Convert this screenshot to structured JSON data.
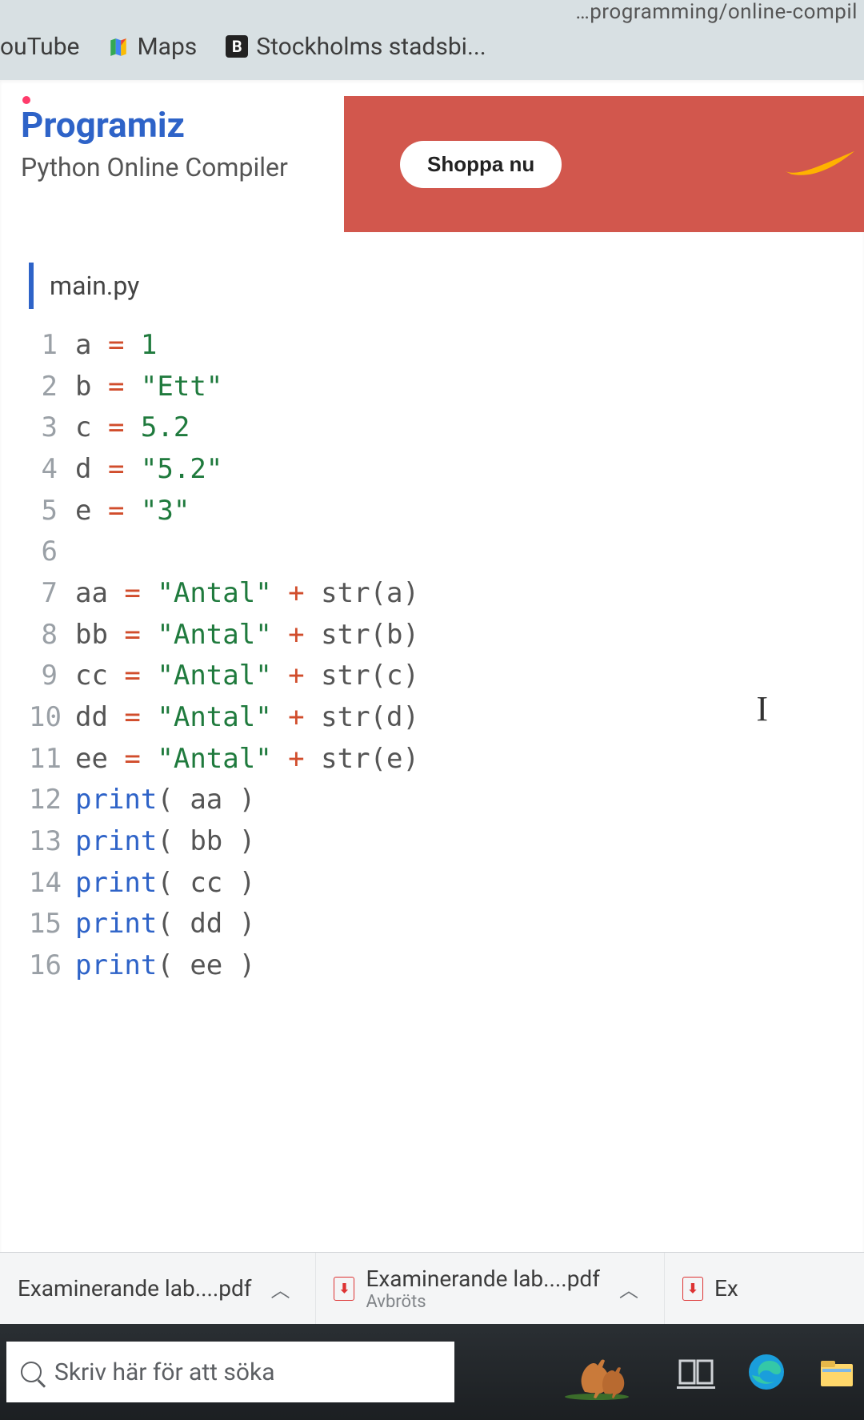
{
  "url_fragment": "…programming/online-compil",
  "bookmarks": {
    "youtube": "ouTube",
    "maps": "Maps",
    "stockholm": "Stockholms stadsbi..."
  },
  "brand": {
    "logo_text": "Programiz",
    "subtitle": "Python Online Compiler"
  },
  "ad": {
    "button_label": "Shoppa nu"
  },
  "editor": {
    "tab": "main.py",
    "lines": [
      {
        "n": "1",
        "tokens": [
          [
            "id",
            "a "
          ],
          [
            "op",
            "="
          ],
          [
            "id",
            " "
          ],
          [
            "num",
            "1"
          ]
        ]
      },
      {
        "n": "2",
        "tokens": [
          [
            "id",
            "b "
          ],
          [
            "op",
            "="
          ],
          [
            "id",
            " "
          ],
          [
            "str",
            "\"Ett\""
          ]
        ]
      },
      {
        "n": "3",
        "tokens": [
          [
            "id",
            "c "
          ],
          [
            "op",
            "="
          ],
          [
            "id",
            " "
          ],
          [
            "num",
            "5.2"
          ]
        ]
      },
      {
        "n": "4",
        "tokens": [
          [
            "id",
            "d "
          ],
          [
            "op",
            "="
          ],
          [
            "id",
            " "
          ],
          [
            "str",
            "\"5.2\""
          ]
        ]
      },
      {
        "n": "5",
        "tokens": [
          [
            "id",
            "e "
          ],
          [
            "op",
            "="
          ],
          [
            "id",
            " "
          ],
          [
            "str",
            "\"3\""
          ]
        ]
      },
      {
        "n": "6",
        "tokens": []
      },
      {
        "n": "7",
        "tokens": [
          [
            "id",
            "aa "
          ],
          [
            "op",
            "="
          ],
          [
            "id",
            " "
          ],
          [
            "str",
            "\"Antal\""
          ],
          [
            "id",
            " "
          ],
          [
            "op",
            "+"
          ],
          [
            "id",
            " str"
          ],
          [
            "pun",
            "("
          ],
          [
            "id",
            "a"
          ],
          [
            "pun",
            ")"
          ]
        ]
      },
      {
        "n": "8",
        "tokens": [
          [
            "id",
            "bb "
          ],
          [
            "op",
            "="
          ],
          [
            "id",
            " "
          ],
          [
            "str",
            "\"Antal\""
          ],
          [
            "id",
            " "
          ],
          [
            "op",
            "+"
          ],
          [
            "id",
            " str"
          ],
          [
            "pun",
            "("
          ],
          [
            "id",
            "b"
          ],
          [
            "pun",
            ")"
          ]
        ]
      },
      {
        "n": "9",
        "tokens": [
          [
            "id",
            "cc "
          ],
          [
            "op",
            "="
          ],
          [
            "id",
            " "
          ],
          [
            "str",
            "\"Antal\""
          ],
          [
            "id",
            " "
          ],
          [
            "op",
            "+"
          ],
          [
            "id",
            " str"
          ],
          [
            "pun",
            "("
          ],
          [
            "id",
            "c"
          ],
          [
            "pun",
            ")"
          ]
        ]
      },
      {
        "n": "10",
        "tokens": [
          [
            "id",
            "dd "
          ],
          [
            "op",
            "="
          ],
          [
            "id",
            " "
          ],
          [
            "str",
            "\"Antal\""
          ],
          [
            "id",
            " "
          ],
          [
            "op",
            "+"
          ],
          [
            "id",
            " str"
          ],
          [
            "pun",
            "("
          ],
          [
            "id",
            "d"
          ],
          [
            "pun",
            ")"
          ]
        ]
      },
      {
        "n": "11",
        "tokens": [
          [
            "id",
            "ee "
          ],
          [
            "op",
            "="
          ],
          [
            "id",
            " "
          ],
          [
            "str",
            "\"Antal\""
          ],
          [
            "id",
            " "
          ],
          [
            "op",
            "+"
          ],
          [
            "id",
            " str"
          ],
          [
            "pun",
            "("
          ],
          [
            "id",
            "e"
          ],
          [
            "pun",
            ")"
          ]
        ]
      },
      {
        "n": "12",
        "tokens": [
          [
            "kw",
            "print"
          ],
          [
            "pun",
            "("
          ],
          [
            "id",
            " aa "
          ],
          [
            "pun",
            ")"
          ]
        ]
      },
      {
        "n": "13",
        "tokens": [
          [
            "kw",
            "print"
          ],
          [
            "pun",
            "("
          ],
          [
            "id",
            " bb "
          ],
          [
            "pun",
            ")"
          ]
        ]
      },
      {
        "n": "14",
        "tokens": [
          [
            "kw",
            "print"
          ],
          [
            "pun",
            "("
          ],
          [
            "id",
            " cc "
          ],
          [
            "pun",
            ")"
          ]
        ]
      },
      {
        "n": "15",
        "tokens": [
          [
            "kw",
            "print"
          ],
          [
            "pun",
            "("
          ],
          [
            "id",
            " dd "
          ],
          [
            "pun",
            ")"
          ]
        ]
      },
      {
        "n": "16",
        "tokens": [
          [
            "kw",
            "print"
          ],
          [
            "pun",
            "("
          ],
          [
            "id",
            " ee "
          ],
          [
            "pun",
            ")"
          ]
        ]
      }
    ]
  },
  "downloads": {
    "item1": {
      "name": "Examinerande lab....pdf"
    },
    "item2": {
      "name": "Examinerande lab....pdf",
      "status": "Avbröts"
    },
    "item3_prefix": "Ex"
  },
  "taskbar": {
    "search_placeholder": "Skriv här för att söka"
  }
}
